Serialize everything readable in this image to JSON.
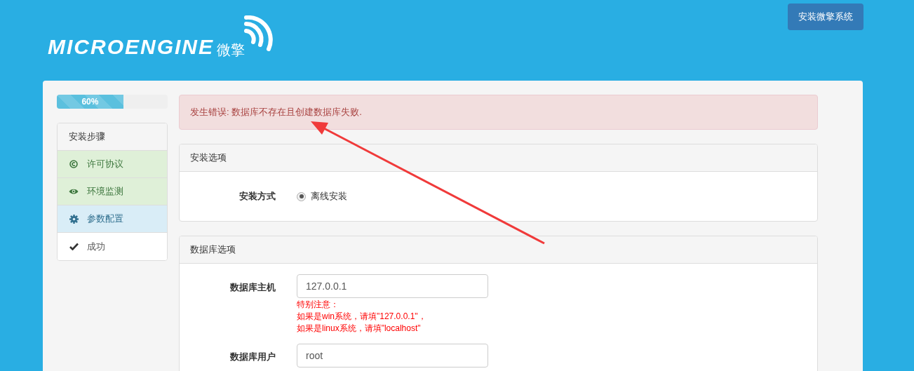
{
  "header": {
    "logo_text": "MICROENGINE",
    "logo_cn": "微擎",
    "install_button": "安装微擎系统"
  },
  "progress": {
    "level": 0.6,
    "label": "60%"
  },
  "steps": {
    "title": "安装步骤",
    "items": [
      {
        "label": "许可协议",
        "completed": true,
        "selected": false
      },
      {
        "label": "环境监测",
        "completed": true,
        "selected": false
      },
      {
        "label": "参数配置",
        "completed": false,
        "selected": true
      },
      {
        "label": "成功",
        "completed": false,
        "selected": false
      }
    ]
  },
  "error_alert": "发生错误: 数据库不存在且创建数据库失败.",
  "install_options": {
    "title": "安装选项",
    "field_label": "安装方式",
    "options": [
      {
        "label": "离线安装",
        "selected": true
      }
    ]
  },
  "database_options": {
    "title": "数据库选项",
    "fields": [
      {
        "label": "数据库主机",
        "value": "127.0.0.1",
        "hint_lines": [
          "特别注意：",
          "如果是win系统，请填\"127.0.0.1\"，",
          "如果是linux系统，请填\"localhost\""
        ]
      },
      {
        "label": "数据库用户",
        "value": "root"
      }
    ]
  }
}
